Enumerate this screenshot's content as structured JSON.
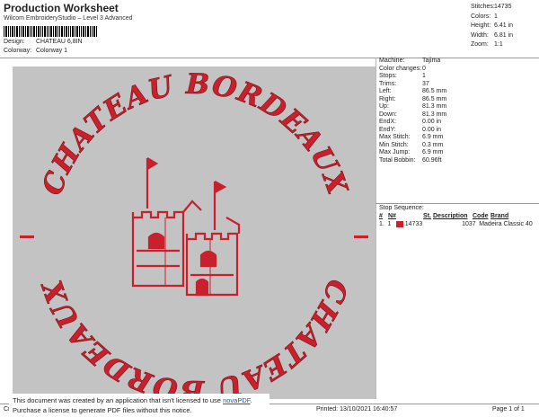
{
  "header": {
    "title": "Production Worksheet",
    "software": "Wilcom EmbroideryStudio – Level 3 Advanced",
    "design_label": "Design:",
    "design_value": "CHATEAU 6,8IN",
    "colorway_label": "Colorway:",
    "colorway_value": "Colorway 1"
  },
  "stats": {
    "stitches_label": "Stitches:",
    "stitches": "14735",
    "colors_label": "Colors:",
    "colors": "1",
    "height_label": "Height:",
    "height": "6.41 in",
    "width_label": "Width:",
    "width": "6.81 in",
    "zoom_label": "Zoom:",
    "zoom": "1:1"
  },
  "machine_panel": [
    {
      "label": "Machine:",
      "value": "Tajima"
    },
    {
      "label": "Color changes:",
      "value": "0"
    },
    {
      "label": "Stops:",
      "value": "1"
    },
    {
      "label": "Trims:",
      "value": "37"
    },
    {
      "label": "Left:",
      "value": "86.5 mm"
    },
    {
      "label": "Right:",
      "value": "86.5 mm"
    },
    {
      "label": "Up:",
      "value": "81.3 mm"
    },
    {
      "label": "Down:",
      "value": "81.3 mm"
    },
    {
      "label": "EndX:",
      "value": "0.00 in"
    },
    {
      "label": "EndY:",
      "value": "0.00 in"
    },
    {
      "label": "Max Stitch:",
      "value": "6.9 mm"
    },
    {
      "label": "Min Stitch:",
      "value": "0.3 mm"
    },
    {
      "label": "Max Jump:",
      "value": "6.9 mm"
    },
    {
      "label": "Total Bobbin:",
      "value": "60.96ft"
    }
  ],
  "stop_sequence": {
    "title": "Stop Sequence:",
    "columns": {
      "num": "#",
      "n": "N#",
      "st": "St.",
      "desc": "Description",
      "code": "Code",
      "brand": "Brand"
    },
    "rows": [
      {
        "num": "1.",
        "n": "1",
        "st": "14733",
        "desc": "",
        "code": "1037",
        "brand": "Madeira Classic 40",
        "color": "#c8202c"
      }
    ]
  },
  "design": {
    "top_text": "CHATEAU BORDEAUX",
    "bottom_text": "CHATEAU BORDEAUX",
    "thread_color": "#c8202c",
    "bg_color": "#c3c3c3"
  },
  "notice": {
    "line1_a": "This document was created by an application that isn't licensed to use ",
    "link": "novaPDF",
    "line1_b": ".",
    "line2": "Purchase a license to generate PDF files without this notice."
  },
  "footer": {
    "left": "Cr",
    "printed": "Printed: 13/10/2021 16:40:57",
    "page": "Page 1 of 1"
  }
}
